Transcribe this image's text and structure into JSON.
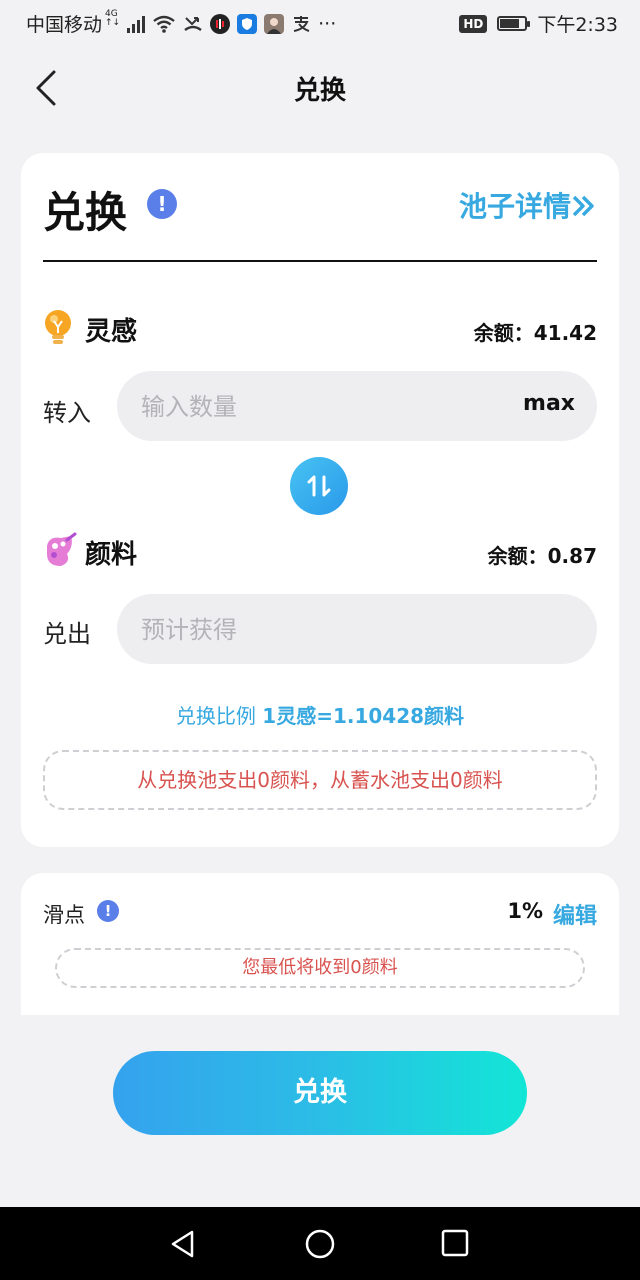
{
  "status_bar": {
    "carrier": "中国移动",
    "network": "4G",
    "network_sub": "↑↓",
    "time": "下午2:33",
    "hd_label": "HD",
    "more": "···",
    "battery_level": 0.8
  },
  "header": {
    "title": "兑换",
    "back_icon": "chevron-left-icon"
  },
  "exchange": {
    "title": "兑换",
    "info_icon": "!",
    "pool_link": "池子详情",
    "pool_link_icon": "double-chevron-right-icon"
  },
  "from_token": {
    "name": "灵感",
    "icon": "lightbulb-icon",
    "balance_label": "余额：41.42",
    "field_label": "转入",
    "placeholder": "输入数量",
    "value": "",
    "max_label": "max"
  },
  "swap_icon": "swap-arrows-icon",
  "to_token": {
    "name": "颜料",
    "icon": "paint-palette-icon",
    "balance_label": "余额：0.87",
    "field_label": "兑出",
    "placeholder": "预计获得",
    "value": ""
  },
  "rate": {
    "label": "兑换比例 ",
    "value": "1灵感=1.10428颜料"
  },
  "pool_notice": "从兑换池支出0颜料，从蓄水池支出0颜料",
  "slippage": {
    "label": "滑点",
    "info_icon": "!",
    "value": "1%",
    "edit_label": "编辑",
    "notice": "您最低将收到0颜料"
  },
  "submit_label": "兑换",
  "colors": {
    "accent": "#37a9e0",
    "info": "#5a7fe8",
    "warning_text": "#d8534f",
    "background": "#f2f2f4",
    "button_gradient_start": "#35a2ee",
    "button_gradient_end": "#12e6d6"
  }
}
